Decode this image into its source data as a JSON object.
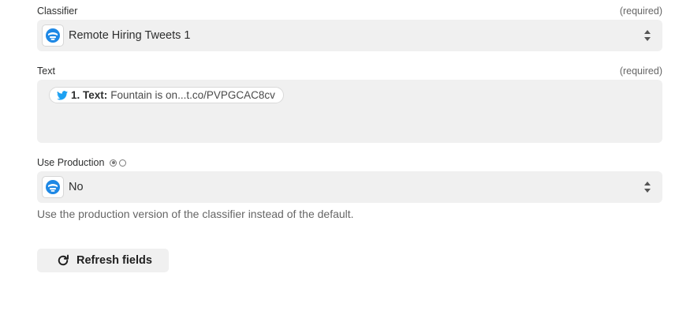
{
  "classifier": {
    "label": "Classifier",
    "required": "(required)",
    "value": "Remote Hiring Tweets 1",
    "icon": "monkeylearn-app-icon"
  },
  "text_field": {
    "label": "Text",
    "required": "(required)",
    "pill_prefix": "1. Text:",
    "pill_value": "Fountain is on...t.co/PVPGCAC8cv",
    "pill_icon": "twitter-bird-icon"
  },
  "use_production": {
    "label": "Use Production",
    "value": "No",
    "help": "Use the production version of the classifier instead of the default.",
    "icon": "monkeylearn-app-icon"
  },
  "refresh": {
    "label": "Refresh fields",
    "icon": "refresh-icon"
  },
  "colors": {
    "twitter": "#1da1f2",
    "app_icon": "#1e88e5",
    "field_bg": "#f0f0f0"
  }
}
